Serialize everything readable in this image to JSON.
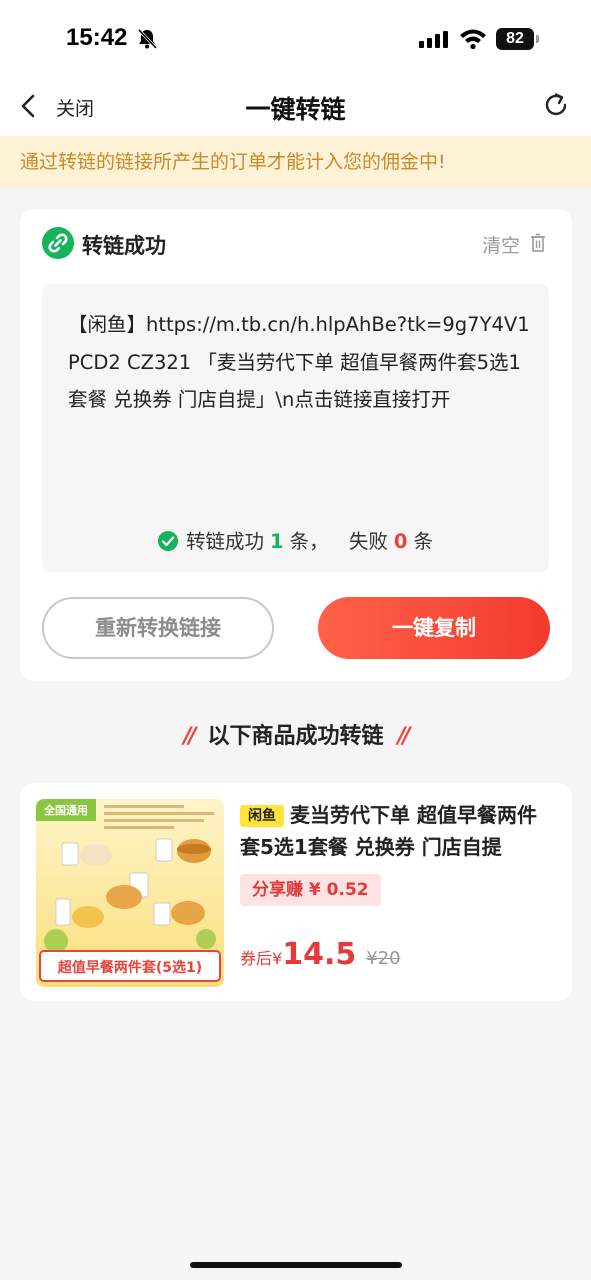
{
  "status_bar": {
    "time": "15:42",
    "battery": "82"
  },
  "nav": {
    "close_label": "关闭",
    "title": "一键转链"
  },
  "notice": "通过转链的链接所产生的订单才能计入您的佣金中!",
  "card": {
    "title": "转链成功",
    "clear_label": "清空",
    "link_text": "【闲鱼】https://m.tb.cn/h.hlpAhBe?tk=9g7Y4V1PCD2 CZ321 「麦当劳代下单 超值早餐两件套5选1套餐 兑换券 门店自提」\\n点击链接直接打开",
    "result": {
      "success_prefix": "转链成功",
      "success_count": "1",
      "success_unit": "条，",
      "fail_prefix": "失败",
      "fail_count": "0",
      "fail_unit": "条"
    },
    "reconvert_label": "重新转换链接",
    "copy_label": "一键复制"
  },
  "section_title": "以下商品成功转链",
  "product": {
    "platform_badge": "闲鱼",
    "title": "麦当劳代下单 超值早餐两件套5选1套餐 兑换券 门店自提",
    "share_label": "分享赚 ¥ 0.52",
    "after_coupon_label": "券后",
    "price_symbol": "¥",
    "price": "14.5",
    "original_price": "¥20",
    "image_tag": "全国通用",
    "image_caption": "超值早餐两件套(5选1)"
  },
  "colors": {
    "accent_red": "#f23a2e",
    "success_green": "#16b35a",
    "notice_bg": "#fdf1d6",
    "notice_text": "#c98a2a"
  }
}
